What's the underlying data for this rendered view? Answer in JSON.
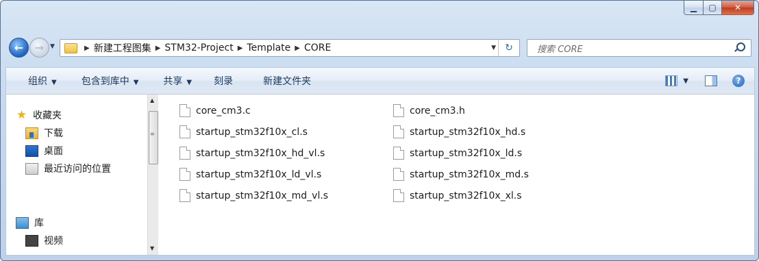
{
  "window": {
    "controls": [
      "minimize-icon",
      "maximize-icon",
      "close-icon"
    ]
  },
  "address": {
    "crumbs": [
      "新建工程图集",
      "STM32-Project",
      "Template",
      "CORE"
    ]
  },
  "search": {
    "placeholder": "搜索 CORE"
  },
  "toolbar": {
    "organize": "组织",
    "include_in_library": "包含到库中",
    "share": "共享",
    "burn": "刻录",
    "new_folder": "新建文件夹"
  },
  "nav": {
    "favorites": "收藏夹",
    "downloads": "下载",
    "desktop": "桌面",
    "recent": "最近访问的位置",
    "libraries": "库",
    "videos": "视频"
  },
  "files": {
    "col1": [
      "core_cm3.c",
      "startup_stm32f10x_cl.s",
      "startup_stm32f10x_hd_vl.s",
      "startup_stm32f10x_ld_vl.s",
      "startup_stm32f10x_md_vl.s"
    ],
    "col2": [
      "core_cm3.h",
      "startup_stm32f10x_hd.s",
      "startup_stm32f10x_ld.s",
      "startup_stm32f10x_md.s",
      "startup_stm32f10x_xl.s"
    ]
  }
}
